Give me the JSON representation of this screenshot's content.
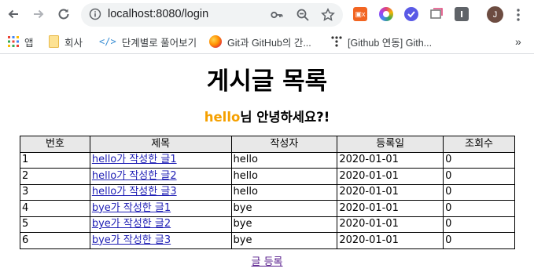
{
  "browser": {
    "url": "localhost:8080/login",
    "bookmarks": [
      {
        "label": "앱",
        "icon": "apps-grid-icon"
      },
      {
        "label": "회사",
        "icon": "folder-icon"
      },
      {
        "label": "단계별로 풀어보기",
        "icon": "code-brackets-icon"
      },
      {
        "label": "Git과 GitHub의 간...",
        "icon": "orange-circle-icon"
      },
      {
        "label": "[Github 연동] Gith...",
        "icon": "dots-tree-icon"
      }
    ],
    "bookmarks_overflow": "»",
    "profile_initial": "J",
    "extensions": [
      {
        "name": "ext-orange-badge",
        "color": "#f26522",
        "text": "▣x"
      },
      {
        "name": "ext-color-wheel",
        "color": "#e0447a"
      },
      {
        "name": "ext-purple-check",
        "color": "#5a5ae6"
      },
      {
        "name": "ext-tabs",
        "color": "#7a7a7a"
      },
      {
        "name": "ext-dark-square",
        "color": "#5f6368",
        "text": "I"
      }
    ]
  },
  "page": {
    "title": "게시글 목록",
    "greeting_user": "hello",
    "greeting_suffix": "님 안녕하세요?!",
    "columns": [
      "번호",
      "제목",
      "작성자",
      "등록일",
      "조회수"
    ],
    "rows": [
      {
        "no": "1",
        "title": "hello가 작성한 글1",
        "writer": "hello",
        "date": "2020-01-01",
        "views": "0"
      },
      {
        "no": "2",
        "title": "hello가 작성한 글2",
        "writer": "hello",
        "date": "2020-01-01",
        "views": "0"
      },
      {
        "no": "3",
        "title": "hello가 작성한 글3",
        "writer": "hello",
        "date": "2020-01-01",
        "views": "0"
      },
      {
        "no": "4",
        "title": "bye가 작성한 글1",
        "writer": "bye",
        "date": "2020-01-01",
        "views": "0"
      },
      {
        "no": "5",
        "title": "bye가 작성한 글2",
        "writer": "bye",
        "date": "2020-01-01",
        "views": "0"
      },
      {
        "no": "6",
        "title": "bye가 작성한 글3",
        "writer": "bye",
        "date": "2020-01-01",
        "views": "0"
      }
    ],
    "write_link": "글 등록"
  },
  "colors": {
    "username": "#f5a000",
    "link": "#1e1eb4",
    "visited_link": "#551a8b",
    "header_bg": "#e8e8e8"
  }
}
